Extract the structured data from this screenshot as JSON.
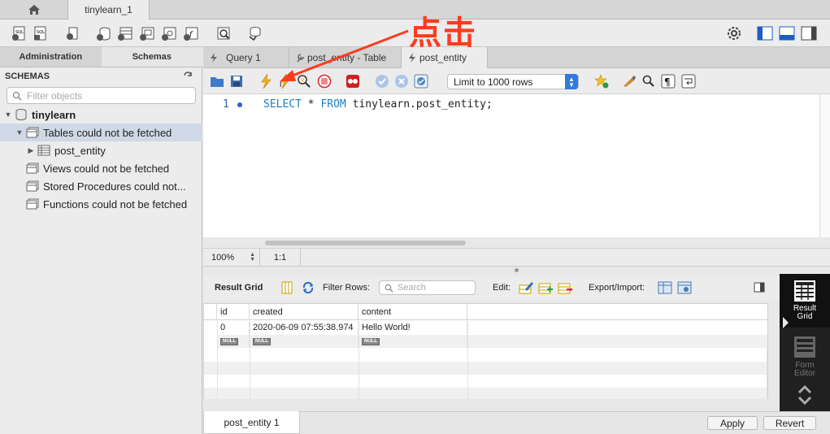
{
  "window": {
    "tab_home_icon": "home-icon",
    "connection_tab": "tinylearn_1"
  },
  "sidebar": {
    "tabs": [
      "Administration",
      "Schemas"
    ],
    "active_tab": "Schemas",
    "header": "SCHEMAS",
    "filter_placeholder": "Filter objects",
    "tree": {
      "schema": "tinylearn",
      "tables_node": "Tables could not be fetched",
      "table": "post_entity",
      "views_node": "Views could not be fetched",
      "procs_node": "Stored Procedures could not...",
      "funcs_node": "Functions could not be fetched"
    }
  },
  "editor_tabs": [
    "Query 1",
    "post_entity - Table",
    "post_entity"
  ],
  "sql_toolbar": {
    "limit_value": "Limit to 1000 rows"
  },
  "editor": {
    "line_number": "1",
    "sql_kw1": "SELECT",
    "sql_mid1": " * ",
    "sql_kw2": "FROM",
    "sql_rest": " tinylearn.post_entity;"
  },
  "zoom": {
    "level": "100%",
    "position": "1:1"
  },
  "results": {
    "result_grid_label": "Result Grid",
    "filter_label": "Filter Rows:",
    "search_placeholder": "Search",
    "edit_label": "Edit:",
    "export_label": "Export/Import:",
    "columns": [
      "id",
      "created",
      "content"
    ],
    "row1": [
      "0",
      "2020-06-09 07:55:38.974",
      "Hello World!"
    ],
    "null_label": "NULL"
  },
  "side_panel": {
    "result_grid": "Result Grid",
    "form_editor": "Form Editor"
  },
  "bottom": {
    "tab": "post_entity 1",
    "apply": "Apply",
    "revert": "Revert"
  },
  "annotation": {
    "text": "点击"
  },
  "colors": {
    "accent": "#2d7be0",
    "annotation": "#ff3b1e"
  }
}
